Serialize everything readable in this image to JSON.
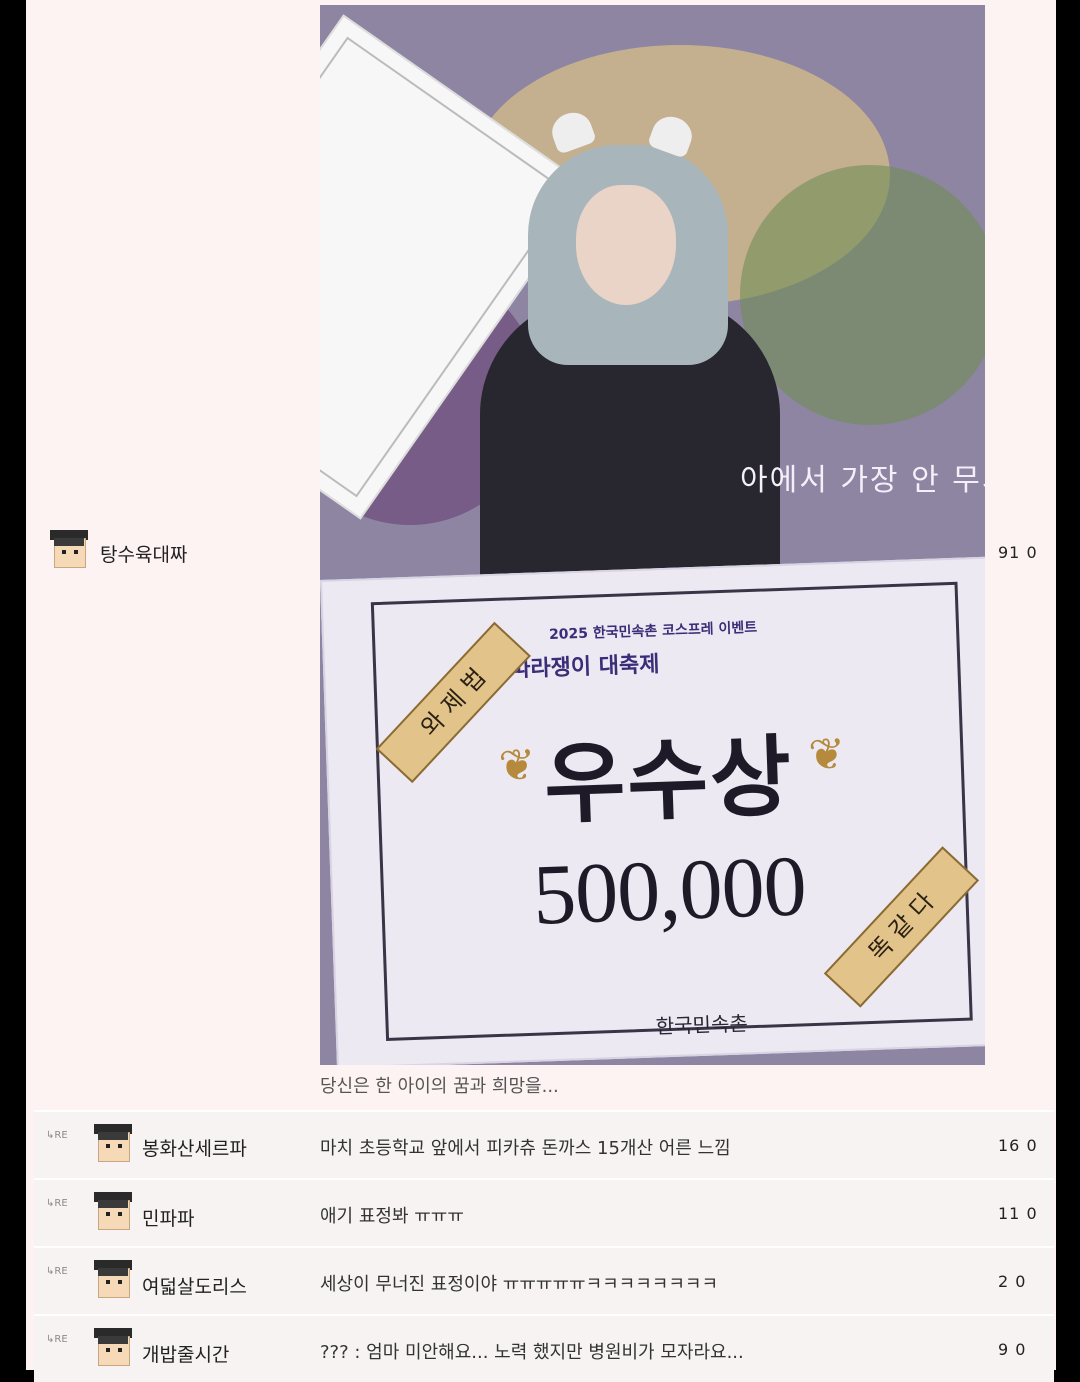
{
  "post": {
    "nickname": "탕수육대짜",
    "vote": "91 0",
    "caption": "당신은 한 아이의 꿈과 희망을...",
    "image": {
      "banner_text": "아에서 가장 안 무서",
      "board_top_line": "2025 한국민속촌 코스프레 이벤트",
      "board_subtitle": "따라쟁이 대축제",
      "award_title": "우수상",
      "award_amount": "500,000",
      "ribbon_left": "와 제 법",
      "ribbon_right": "똑 같 다",
      "organizer": "한국민속촌"
    }
  },
  "replies": [
    {
      "re": "RE",
      "nickname": "봉화산세르파",
      "text": "마치 초등학교 앞에서 피카츄 돈까스 15개산 어른 느낌",
      "vote": "16 0"
    },
    {
      "re": "RE",
      "nickname": "민파파",
      "text": "애기 표정봐 ㅠㅠㅠ",
      "vote": "11 0"
    },
    {
      "re": "RE",
      "nickname": "여덟살도리스",
      "text": "세상이 무너진 표정이야 ㅠㅠㅠㅠㅠㅋㅋㅋㅋㅋㅋㅋㅋ",
      "vote": "2 0"
    },
    {
      "re": "RE",
      "nickname": "개밥줄시간",
      "text": "??? : 엄마 미안해요... 노력 했지만 병원비가 모자라요...",
      "vote": "9 0"
    }
  ],
  "icons": {
    "avatar": "pixel-avatar-icon",
    "reply": "reply-arrow-icon"
  },
  "colors": {
    "background": "#fdf3f3",
    "reply_row": "#f7f3f3",
    "frame": "#000000"
  }
}
